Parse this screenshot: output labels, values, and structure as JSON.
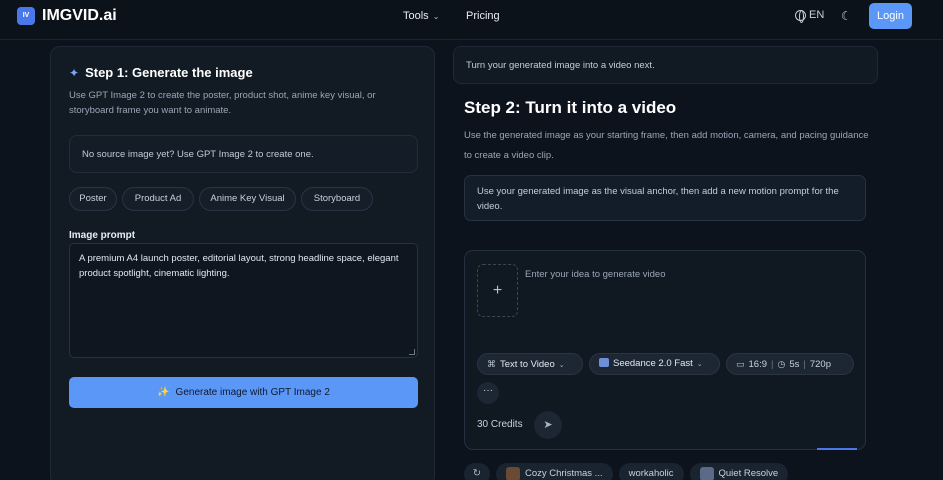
{
  "header": {
    "logo_badge": "IV",
    "brand": "IMGVID.ai",
    "nav": {
      "tools": "Tools",
      "pricing": "Pricing"
    },
    "language": "EN",
    "login": "Login"
  },
  "step1": {
    "title": "Step 1: Generate the image",
    "description": "Use GPT Image 2 to create the poster, product shot, anime key visual, or storyboard frame you want to animate.",
    "no_source": "No source image yet? Use GPT Image 2 to create one.",
    "chips": [
      "Poster",
      "Product Ad",
      "Anime Key Visual",
      "Storyboard"
    ],
    "prompt_label": "Image prompt",
    "prompt_value": "A premium A4 launch poster, editorial layout, strong headline space, elegant product spotlight, cinematic lighting.",
    "generate_button": "Generate image with GPT Image 2"
  },
  "step2": {
    "note": "Turn your generated image into a video next.",
    "title": "Step 2: Turn it into a video",
    "description": "Use the generated image as your starting frame, then add motion, camera, and pacing guidance to create a video clip.",
    "anchor_hint": "Use your generated image as the visual anchor, then add a new motion prompt for the video.",
    "composer": {
      "placeholder": "Enter your idea to generate video",
      "mode": "Text to Video",
      "model": "Seedance 2.0 Fast",
      "aspect": "16:9",
      "duration": "5s",
      "resolution": "720p",
      "credits": "30 Credits"
    },
    "examples": [
      "Cozy Christmas ...",
      "workaholic",
      "Quiet Resolve"
    ]
  },
  "colors": {
    "accent": "#5b97f7",
    "background": "#0d131c",
    "panel": "#121a24"
  }
}
